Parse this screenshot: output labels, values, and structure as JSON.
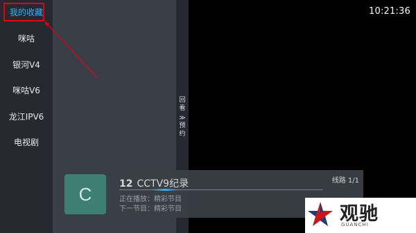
{
  "sidebar": {
    "items": [
      {
        "label": "我的收藏",
        "selected": true
      },
      {
        "label": "咪咕",
        "selected": false
      },
      {
        "label": "银河V4",
        "selected": false
      },
      {
        "label": "咪咕V6",
        "selected": false
      },
      {
        "label": "龙江IPV6",
        "selected": false
      },
      {
        "label": "电视剧",
        "selected": false
      }
    ]
  },
  "epg_strip": {
    "top_chars": [
      "回",
      "看"
    ],
    "arrow": "≫",
    "bottom_chars": [
      "预",
      "约"
    ]
  },
  "clock": {
    "time": "10:21:36"
  },
  "info_bar": {
    "logo_letter": "C",
    "channel_number": "12",
    "channel_name": "CCTV9纪录",
    "route_label": "线路 1/1",
    "now_playing": "正在播放：精彩节目",
    "next_program": "下一节目：精彩节目",
    "progress_percent": 30
  },
  "watermark": {
    "text": "观驰",
    "subtext": "GUANCHI"
  },
  "colors": {
    "sidebar_bg": "#26292f",
    "panel_bg": "#3a3f47",
    "selected_text": "#2fb4ff",
    "highlight_box": "#e60012",
    "logo_tile": "#3d7f73"
  }
}
